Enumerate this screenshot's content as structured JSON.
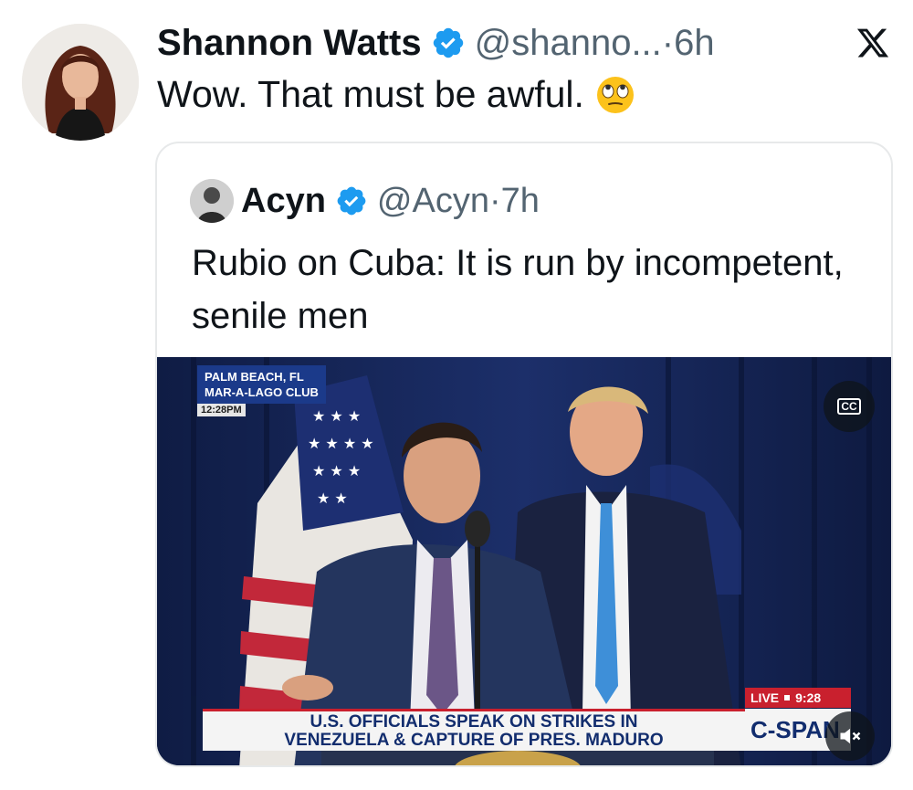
{
  "tweet": {
    "author": {
      "display_name": "Shannon Watts",
      "handle": "@shanno...",
      "verified": true
    },
    "separator": "·",
    "time": "6h",
    "text": "Wow. That must be awful.",
    "emoji": "face-with-rolling-eyes"
  },
  "quoted_tweet": {
    "author": {
      "display_name": "Acyn",
      "handle": "@Acyn",
      "verified": true
    },
    "separator": "·",
    "time": "7h",
    "text": "Rubio on Cuba: It is run by incompetent, senile men",
    "video": {
      "location_line1": "PALM BEACH, FL",
      "location_line2": "MAR-A-LAGO CLUB",
      "local_time": "12:28PM",
      "cc_label": "CC",
      "headline_line1": "U.S. OFFICIALS SPEAK ON STRIKES IN",
      "headline_line2": "VENEZUELA & CAPTURE OF PRES. MADURO",
      "live_label": "LIVE",
      "live_time": "9:28",
      "network": "C-SPAN",
      "muted": true
    }
  },
  "colors": {
    "verified_blue": "#1d9bf0",
    "handle_gray": "#536471",
    "text": "#0f1419",
    "cspan_navy": "#122d6e",
    "cspan_red": "#c9202e"
  },
  "icons": {
    "brand": "x-logo-icon",
    "verified": "verified-badge-icon",
    "captions": "closed-captions-icon",
    "mute": "speaker-muted-icon"
  }
}
